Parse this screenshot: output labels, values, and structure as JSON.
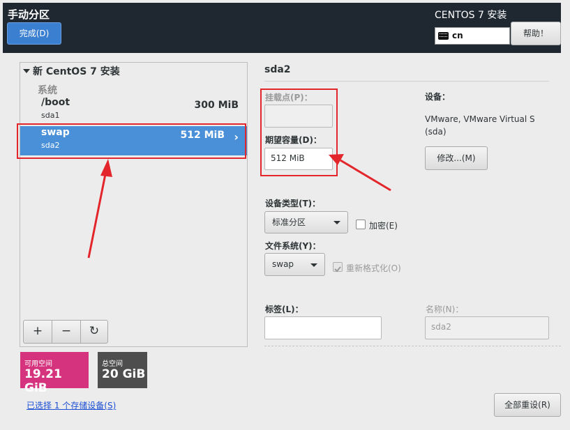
{
  "header": {
    "title": "手动分区",
    "done_label": "完成(D)",
    "product": "CENTOS 7 安装",
    "keyboard_layout": "cn",
    "help_label": "帮助！"
  },
  "tree": {
    "root_label": "新 CentOS 7 安装",
    "group_label": "系统",
    "partitions": [
      {
        "mount": "/boot",
        "device": "sda1",
        "size": "300 MiB"
      },
      {
        "mount": "swap",
        "device": "sda2",
        "size": "512 MiB"
      }
    ],
    "toolbar": {
      "add": "+",
      "remove": "−",
      "refresh": "↻"
    }
  },
  "space": {
    "available_label": "可用空间",
    "available_value": "19.21 GiB",
    "total_label": "总空间",
    "total_value": "20 GiB"
  },
  "selected_devices_link": "已选择 1 个存储设备(S)",
  "detail": {
    "title": "sda2",
    "mount_point_label": "挂载点(P)：",
    "mount_point_value": "",
    "capacity_label": "期望容量(D)：",
    "capacity_value": "512 MiB",
    "device_label": "设备：",
    "device_value_line1": "VMware, VMware Virtual S",
    "device_value_line2": "(sda)",
    "modify_label": "修改...(M)",
    "device_type_label": "设备类型(T)：",
    "device_type_value": "标准分区",
    "encrypt_label": "加密(E)",
    "encrypt_checked": false,
    "filesystem_label": "文件系统(Y)：",
    "filesystem_value": "swap",
    "reformat_label": "重新格式化(O)",
    "reformat_checked": true,
    "tag_label": "标签(L)：",
    "tag_value": "",
    "name_label": "名称(N)：",
    "name_value": "sda2",
    "reset_all_label": "全部重设(R)"
  },
  "colors": {
    "header_bg": "#1f2731",
    "accent": "#3b7fd0",
    "selected_row": "#4a90d9",
    "available_space": "#d6337e",
    "total_space": "#4e4e4e",
    "annotation_red": "#e3262b"
  }
}
